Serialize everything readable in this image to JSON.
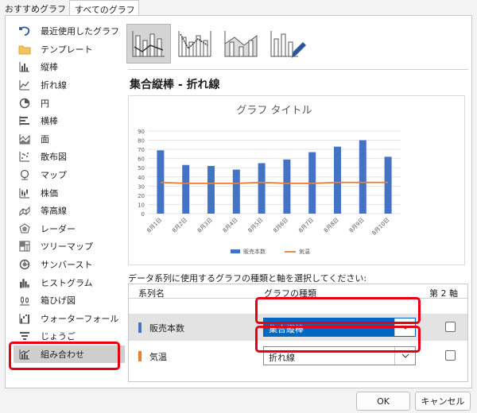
{
  "tabs": [
    "おすすめグラフ",
    "すべてのグラフ"
  ],
  "sidebar": {
    "items": [
      "最近使用したグラフ",
      "テンプレート",
      "縦棒",
      "折れ線",
      "円",
      "横棒",
      "面",
      "散布図",
      "マップ",
      "株価",
      "等高線",
      "レーダー",
      "ツリーマップ",
      "サンバースト",
      "ヒストグラム",
      "箱ひげ図",
      "ウォーターフォール",
      "じょうご",
      "組み合わせ"
    ],
    "selected": "組み合わせ"
  },
  "subtypes": [
    "集合縦棒 - 折れ線",
    "集合縦棒 - 第 2 軸の折れ線",
    "積み上げ面 - 集合縦棒",
    "ユーザー設定の組み合わせ"
  ],
  "main": {
    "chart_type_title": "集合縦棒 - 折れ線",
    "series_instruction": "データ系列に使用するグラフの種類と軸を選択してください:",
    "series_table": {
      "headers": {
        "series": "系列名",
        "type": "グラフの種類",
        "axis": "第 2 軸"
      },
      "rows": [
        {
          "name": "販売本数",
          "type": "集合縦棒",
          "color": "#4472c4",
          "secondary": false
        },
        {
          "name": "気温",
          "type": "折れ線",
          "color": "#ed7d31",
          "secondary": false
        }
      ]
    }
  },
  "chart_data": {
    "type": "bar",
    "title": "グラフ タイトル",
    "categories": [
      "8月1日",
      "8月2日",
      "8月3日",
      "8月4日",
      "8月5日",
      "8月6日",
      "8月7日",
      "8月8日",
      "8月9日",
      "8月10日"
    ],
    "ylim": [
      0,
      90
    ],
    "yticks": [
      0,
      10,
      20,
      30,
      40,
      50,
      60,
      70,
      80,
      90
    ],
    "grid": true,
    "legend": "bottom",
    "series": [
      {
        "name": "販売本数",
        "kind": "bar",
        "color": "#4472c4",
        "values": [
          69,
          53,
          52,
          48,
          55,
          59,
          67,
          73,
          80,
          62
        ]
      },
      {
        "name": "気温",
        "kind": "line",
        "color": "#ed7d31",
        "values": [
          34,
          33,
          33,
          33,
          34,
          33,
          33,
          34,
          34,
          34
        ]
      }
    ]
  },
  "buttons": {
    "ok": "OK",
    "cancel": "キャンセル"
  },
  "colors": {
    "accent": "#0067c0",
    "highlight": "#e60012",
    "selected_bg": "#cfcfcf"
  }
}
